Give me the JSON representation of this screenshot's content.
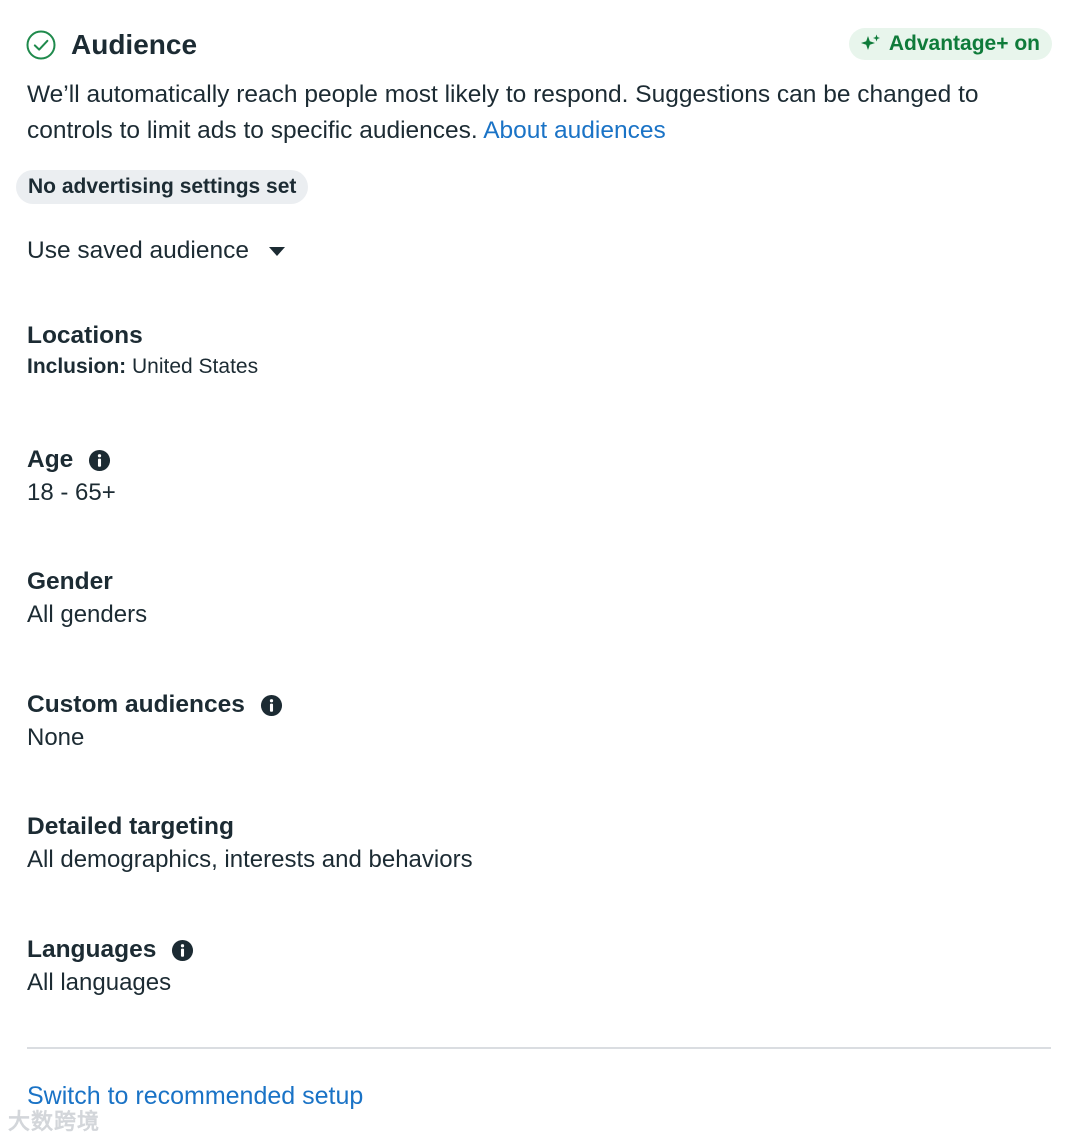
{
  "header": {
    "title": "Audience",
    "advantage_label": "Advantage+ on"
  },
  "description": {
    "text": "We’ll automatically reach people most likely to respond. Suggestions can be changed to controls to limit ads to specific audiences. ",
    "link": "About audiences"
  },
  "status_pill": "No advertising settings set",
  "saved_audience": {
    "label": "Use saved audience"
  },
  "sections": {
    "locations": {
      "title": "Locations",
      "inclusion_label": "Inclusion:",
      "inclusion_value": " United States"
    },
    "age": {
      "title": "Age",
      "value": "18 - 65+"
    },
    "gender": {
      "title": "Gender",
      "value": "All genders"
    },
    "custom_audiences": {
      "title": "Custom audiences",
      "value": "None"
    },
    "detailed_targeting": {
      "title": "Detailed targeting",
      "value": "All demographics, interests and behaviors"
    },
    "languages": {
      "title": "Languages",
      "value": "All languages"
    }
  },
  "footer": {
    "switch_link": "Switch to recommended setup"
  },
  "watermark": "大数跨境",
  "colors": {
    "accent_green": "#0f7b3a",
    "badge_bg": "#e8f5ec",
    "link_blue": "#1a73c6",
    "text": "#1c2b33",
    "pill_bg": "#ebeef1"
  },
  "icons": {
    "check": "check-circle-icon",
    "sparkle": "sparkle-icon",
    "info": "info-icon",
    "caret": "caret-down-icon"
  }
}
